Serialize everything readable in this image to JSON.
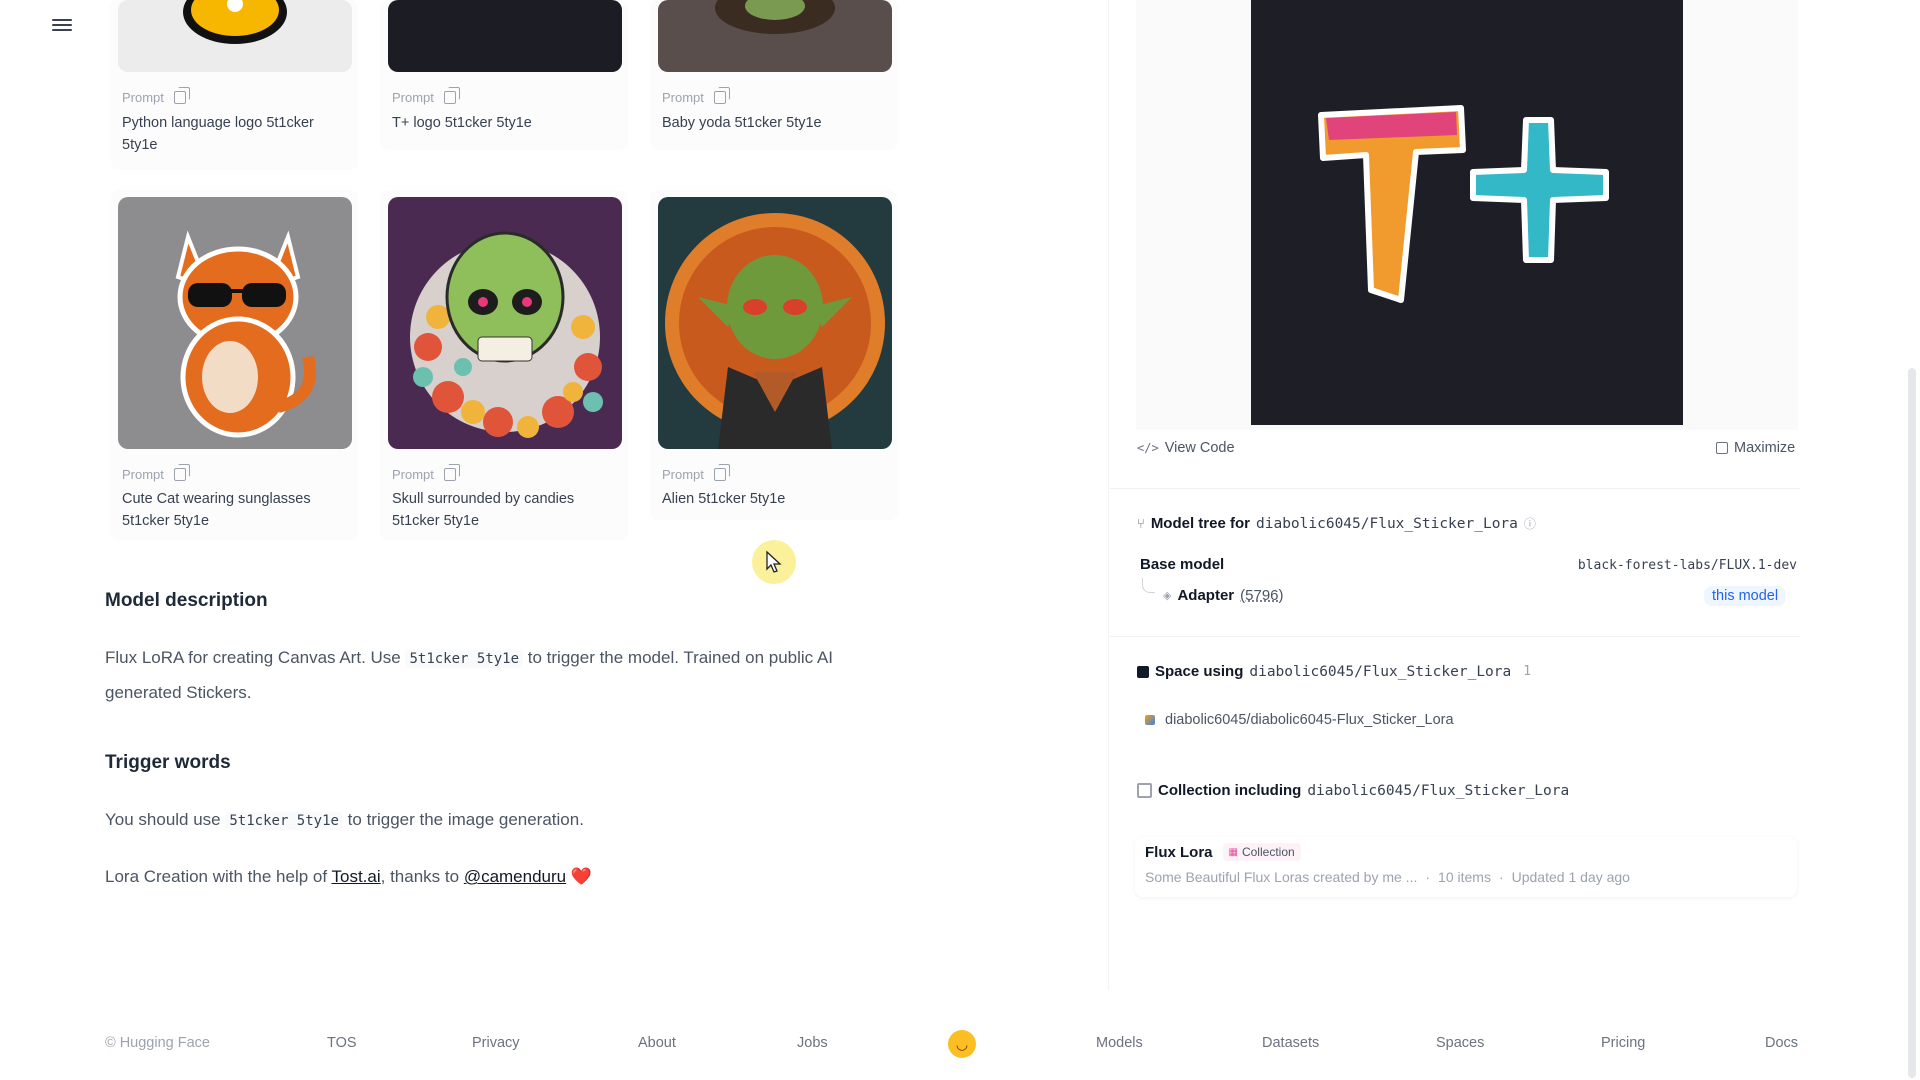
{
  "gallery": {
    "prompt_label": "Prompt",
    "items": [
      {
        "prompt": "Python language logo 5t1cker 5ty1e"
      },
      {
        "prompt": "T+ logo 5t1cker 5ty1e"
      },
      {
        "prompt": "Baby yoda 5t1cker 5ty1e"
      },
      {
        "prompt": "Cute Cat wearing sunglasses 5t1cker 5ty1e"
      },
      {
        "prompt": "Skull surrounded by candies 5t1cker 5ty1e"
      },
      {
        "prompt": "Alien 5t1cker 5ty1e"
      }
    ]
  },
  "description": {
    "heading": "Model description",
    "text_before": "Flux LoRA for creating Canvas Art. Use ",
    "code": "5t1cker 5ty1e",
    "text_after": " to trigger the model. Trained on public AI generated Stickers."
  },
  "trigger": {
    "heading": "Trigger words",
    "text_before": "You should use ",
    "code": "5t1cker 5ty1e",
    "text_after": " to trigger the image generation.",
    "credit_before": "Lora Creation with the help of ",
    "credit_link1": "Tost.ai",
    "credit_mid": ", thanks to ",
    "credit_link2": "@camenduru",
    "heart": "❤️"
  },
  "widget": {
    "view_code": "View Code",
    "maximize": "Maximize"
  },
  "model_tree": {
    "label": "Model tree for",
    "repo": "diabolic6045/Flux_Sticker_Lora",
    "base_model_label": "Base model",
    "base_model_value": "black-forest-labs/FLUX.1-dev",
    "adapter_label": "Adapter",
    "adapter_count": "(5796)",
    "this_model": "this model"
  },
  "spaces": {
    "label": "Space using",
    "repo": "diabolic6045/Flux_Sticker_Lora",
    "count": "1",
    "item": "diabolic6045/diabolic6045-Flux_Sticker_Lora"
  },
  "collection": {
    "label": "Collection including",
    "repo": "diabolic6045/Flux_Sticker_Lora",
    "name": "Flux Lora",
    "badge": "Collection",
    "desc": "Some Beautiful Flux Loras created by me ...",
    "items": "10 items",
    "updated": "Updated 1 day ago"
  },
  "footer": {
    "copyright": "© Hugging Face",
    "links": [
      "TOS",
      "Privacy",
      "About",
      "Jobs",
      "Models",
      "Datasets",
      "Spaces",
      "Pricing",
      "Docs"
    ]
  },
  "colors": {
    "accent": "#2563eb",
    "heart": "#ef4444",
    "sticker_bg": "#1e1e26"
  }
}
